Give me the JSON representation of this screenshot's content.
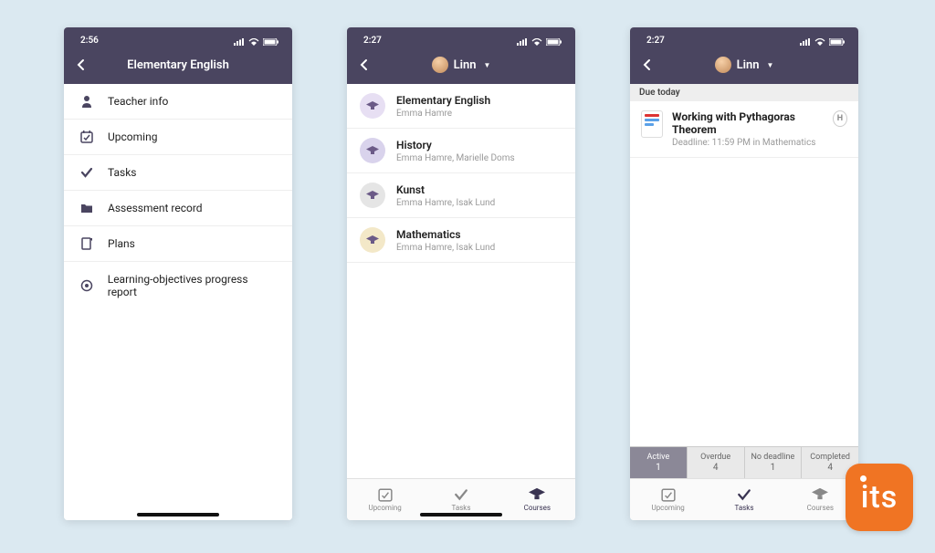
{
  "logo_text": "its",
  "phones": [
    {
      "status_time": "2:56",
      "header_title": "Elementary English",
      "menu": [
        {
          "icon": "person",
          "label": "Teacher info"
        },
        {
          "icon": "calendar-check",
          "label": "Upcoming"
        },
        {
          "icon": "check",
          "label": "Tasks"
        },
        {
          "icon": "folder",
          "label": "Assessment record"
        },
        {
          "icon": "plans",
          "label": "Plans"
        },
        {
          "icon": "target",
          "label": "Learning-objectives progress report"
        }
      ]
    },
    {
      "status_time": "2:27",
      "header_user": "Linn",
      "courses": [
        {
          "title": "Elementary English",
          "subtitle": "Emma Hamre",
          "color": "#e7dff3"
        },
        {
          "title": "History",
          "subtitle": "Emma Hamre, Marielle Doms",
          "color": "#d9d3ec"
        },
        {
          "title": "Kunst",
          "subtitle": "Emma Hamre, Isak Lund",
          "color": "#e5e5e5"
        },
        {
          "title": "Mathematics",
          "subtitle": "Emma Hamre, Isak Lund",
          "color": "#f3e8c8"
        }
      ],
      "tabs": [
        {
          "label": "Upcoming",
          "icon": "calendar-check",
          "active": false
        },
        {
          "label": "Tasks",
          "icon": "check",
          "active": false
        },
        {
          "label": "Courses",
          "icon": "cap",
          "active": true
        }
      ]
    },
    {
      "status_time": "2:27",
      "header_user": "Linn",
      "section_title": "Due today",
      "task": {
        "title": "Working with Pythagoras Theorem",
        "subtitle": "Deadline: 11:59 PM in Mathematics",
        "badge": "H"
      },
      "filters": [
        {
          "label": "Active",
          "count": "1",
          "active": true
        },
        {
          "label": "Overdue",
          "count": "4",
          "active": false
        },
        {
          "label": "No deadline",
          "count": "1",
          "active": false
        },
        {
          "label": "Completed",
          "count": "4",
          "active": false
        }
      ],
      "tabs": [
        {
          "label": "Upcoming",
          "icon": "calendar-check",
          "active": false
        },
        {
          "label": "Tasks",
          "icon": "check",
          "active": true
        },
        {
          "label": "Courses",
          "icon": "cap",
          "active": false
        }
      ]
    }
  ]
}
